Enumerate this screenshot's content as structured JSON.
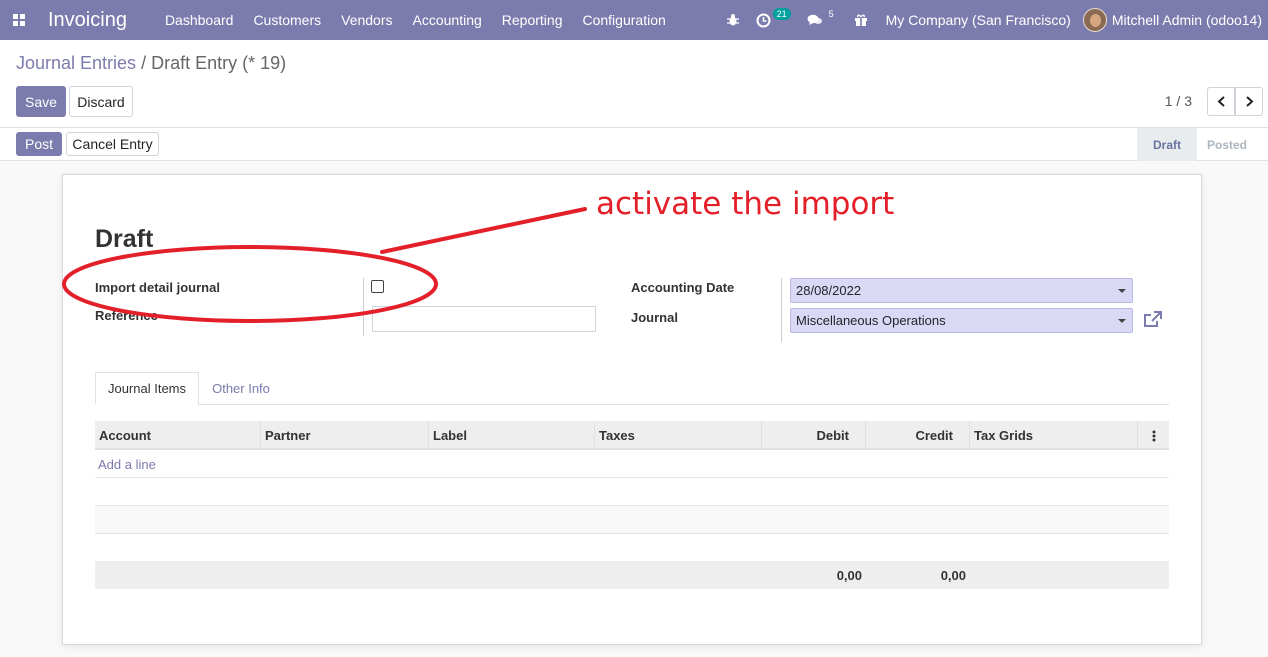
{
  "navbar": {
    "app_name": "Invoicing",
    "menu": [
      "Dashboard",
      "Customers",
      "Vendors",
      "Accounting",
      "Reporting",
      "Configuration"
    ],
    "activity_count": "21",
    "message_count": "5",
    "company": "My Company (San Francisco)",
    "user": "Mitchell Admin (odoo14)"
  },
  "breadcrumb": {
    "parent": "Journal Entries",
    "separator": "/",
    "current": "Draft Entry (* 19)"
  },
  "toolbar": {
    "save_label": "Save",
    "discard_label": "Discard"
  },
  "pager": {
    "value": "1 / 3"
  },
  "header_buttons": {
    "post_label": "Post",
    "cancel_label": "Cancel Entry"
  },
  "statusbar": {
    "stages": [
      "Draft",
      "Posted"
    ],
    "active": "Draft"
  },
  "form": {
    "title": "Draft",
    "import_label": "Import detail journal",
    "import_checked": false,
    "reference_label": "Reference",
    "reference_value": "",
    "accounting_date_label": "Accounting Date",
    "accounting_date_value": "28/08/2022",
    "journal_label": "Journal",
    "journal_value": "Miscellaneous Operations"
  },
  "tabs": [
    "Journal Items",
    "Other Info"
  ],
  "table": {
    "columns": [
      "Account",
      "Partner",
      "Label",
      "Taxes",
      "Debit",
      "Credit",
      "Tax Grids"
    ],
    "add_line": "Add a line",
    "total_debit": "0,00",
    "total_credit": "0,00"
  },
  "annotation": {
    "text": "activate the import",
    "color": "#e3202a"
  },
  "colors": {
    "brand": "#7c7bad",
    "select_bg": "#d9d9f5"
  }
}
